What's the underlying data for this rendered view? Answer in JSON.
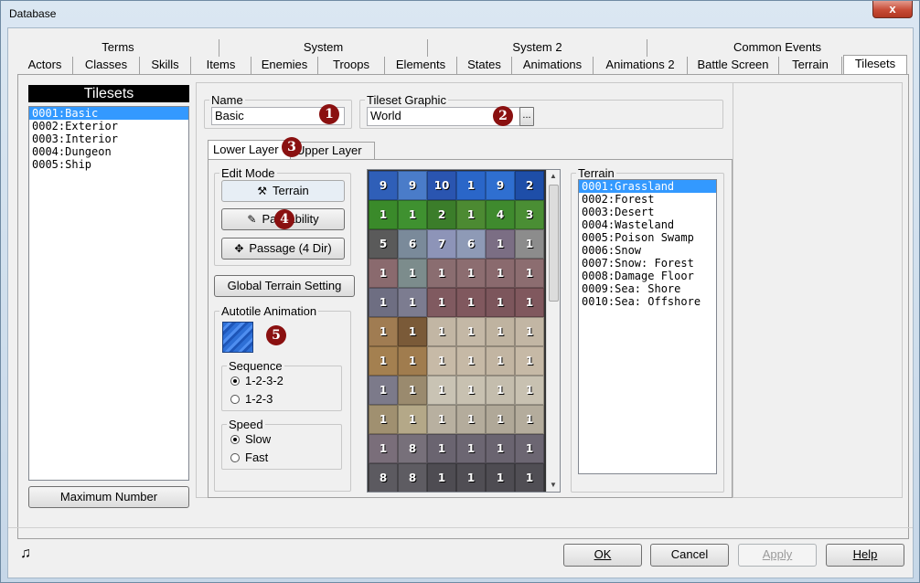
{
  "window": {
    "title": "Database",
    "close_glyph": "x"
  },
  "tabs_top": [
    "Terms",
    "System",
    "System 2",
    "Common Events"
  ],
  "tabs_bottom": [
    "Actors",
    "Classes",
    "Skills",
    "Items",
    "Enemies",
    "Troops",
    "Elements",
    "States",
    "Animations",
    "Animations 2",
    "Battle Screen",
    "Terrain",
    "Tilesets"
  ],
  "tilesets": {
    "header": "Tilesets",
    "items": [
      "0001:Basic",
      "0002:Exterior",
      "0003:Interior",
      "0004:Dungeon",
      "0005:Ship"
    ],
    "selected_index": 0,
    "max_button": "Maximum Number"
  },
  "name": {
    "label": "Name",
    "value": "Basic"
  },
  "graphic": {
    "label": "Tileset Graphic",
    "value": "World",
    "browse": "..."
  },
  "layer_tabs": [
    "Lower Layer",
    "Upper Layer"
  ],
  "edit_mode": {
    "label": "Edit Mode",
    "terrain_button": "Terrain",
    "passability_button": "Passability",
    "passage_button": "Passage (4 Dir)"
  },
  "global_terrain_button": "Global Terrain Setting",
  "autotile": {
    "label": "Autotile Animation",
    "preview_color": "#2d6fd8"
  },
  "sequence": {
    "label": "Sequence",
    "options": [
      "1-2-3-2",
      "1-2-3"
    ],
    "selected_index": 0
  },
  "speed": {
    "label": "Speed",
    "options": [
      "Slow",
      "Fast"
    ],
    "selected_index": 0
  },
  "terrain": {
    "label": "Terrain",
    "items": [
      "0001:Grassland",
      "0002:Forest",
      "0003:Desert",
      "0004:Wasteland",
      "0005:Poison Swamp",
      "0006:Snow",
      "0007:Snow: Forest",
      "0008:Damage Floor",
      "0009:Sea: Shore",
      "0010:Sea: Offshore"
    ],
    "selected_index": 0
  },
  "tile_grid": [
    [
      "9",
      "9",
      "10",
      "1",
      "9",
      "2"
    ],
    [
      "1",
      "1",
      "2",
      "1",
      "4",
      "3"
    ],
    [
      "5",
      "6",
      "7",
      "6",
      "1",
      "1"
    ],
    [
      "1",
      "1",
      "1",
      "1",
      "1",
      "1"
    ],
    [
      "1",
      "1",
      "1",
      "1",
      "1",
      "1"
    ],
    [
      "1",
      "1",
      "1",
      "1",
      "1",
      "1"
    ],
    [
      "1",
      "1",
      "1",
      "1",
      "1",
      "1"
    ],
    [
      "1",
      "1",
      "1",
      "1",
      "1",
      "1"
    ],
    [
      "1",
      "1",
      "1",
      "1",
      "1",
      "1"
    ],
    [
      "1",
      "8",
      "1",
      "1",
      "1",
      "1"
    ],
    [
      "8",
      "8",
      "1",
      "1",
      "1",
      "1"
    ]
  ],
  "tile_colors": [
    [
      "#2f5fb8",
      "#4a7cc9",
      "#2a55b0",
      "#2a66c8",
      "#2f6fd0",
      "#1e4ea8"
    ],
    [
      "#3a8a2a",
      "#3f9130",
      "#3b7d2a",
      "#4c8a32",
      "#3f8a2e",
      "#4a8e34"
    ],
    [
      "#5a5a5a",
      "#7a8a9a",
      "#8d94b8",
      "#8e9ab6",
      "#7b6e84",
      "#8c8c8c"
    ],
    [
      "#8a6a6e",
      "#7c8c8c",
      "#8a6d70",
      "#8c6d70",
      "#8a6a6e",
      "#8c6d70"
    ],
    [
      "#6e6e82",
      "#7c7c90",
      "#805a60",
      "#80585e",
      "#7c565c",
      "#80585e"
    ],
    [
      "#a07c52",
      "#7a5a38",
      "#c2b6a4",
      "#c4b8a6",
      "#bfb3a0",
      "#c2b6a4"
    ],
    [
      "#a48050",
      "#a07c4e",
      "#c7baa7",
      "#c6b9a6",
      "#c2b5a2",
      "#c6b9a6"
    ],
    [
      "#7c7a8a",
      "#9a8a6e",
      "#c9c3b4",
      "#c8c1b1",
      "#c4bdad",
      "#c8c1b1"
    ],
    [
      "#a09070",
      "#b4a888",
      "#b8b0a0",
      "#b4ac9c",
      "#b0a898",
      "#b4ac9c"
    ],
    [
      "#7a6e7a",
      "#77707a",
      "#6a6470",
      "#6c6672",
      "#6a6470",
      "#6c6672"
    ],
    [
      "#5c5a60",
      "#5e5c62",
      "#4e4c52",
      "#504e54",
      "#4e4c52",
      "#504e54"
    ]
  ],
  "badges": [
    "1",
    "2",
    "3",
    "4",
    "5"
  ],
  "footer": {
    "ok": "OK",
    "cancel": "Cancel",
    "apply": "Apply",
    "help": "Help",
    "music_icon": "♫"
  }
}
